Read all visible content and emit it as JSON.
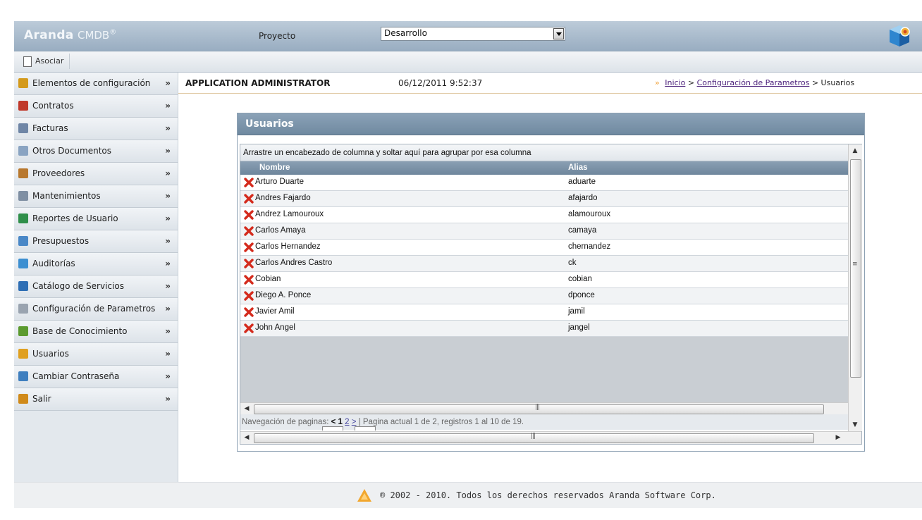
{
  "header": {
    "logo_main": "Aranda",
    "logo_sub": "CMDB",
    "logo_mark": "®",
    "project_label": "Proyecto",
    "project_value": "Desarrollo"
  },
  "toolbar": {
    "asociar_label": "Asociar"
  },
  "sidebar": {
    "items": [
      {
        "label": "Elementos de configuración",
        "icon": "config-elements-icon",
        "color": "#d49a1c"
      },
      {
        "label": "Contratos",
        "icon": "contract-pen-icon",
        "color": "#c0392b"
      },
      {
        "label": "Facturas",
        "icon": "invoice-icon",
        "color": "#6f86a6"
      },
      {
        "label": "Otros Documentos",
        "icon": "documents-icon",
        "color": "#8aa4c2"
      },
      {
        "label": "Proveedores",
        "icon": "supplier-icon",
        "color": "#b8782e"
      },
      {
        "label": "Mantenimientos",
        "icon": "maintenance-icon",
        "color": "#7f8fa3"
      },
      {
        "label": "Reportes de Usuario",
        "icon": "user-report-icon",
        "color": "#2f8f4a"
      },
      {
        "label": "Presupuestos",
        "icon": "calculator-icon",
        "color": "#4a88c7"
      },
      {
        "label": "Auditorías",
        "icon": "audit-icon",
        "color": "#3c8fd1"
      },
      {
        "label": "Catálogo de Servicios",
        "icon": "service-catalog-icon",
        "color": "#2f6fb5"
      },
      {
        "label": "Configuración de Parametros",
        "icon": "gear-icon",
        "color": "#9aa4b0"
      },
      {
        "label": "Base de Conocimiento",
        "icon": "knowledge-books-icon",
        "color": "#5b9a2f"
      },
      {
        "label": "Usuarios",
        "icon": "users-icon",
        "color": "#e0a020"
      },
      {
        "label": "Cambiar Contraseña",
        "icon": "change-password-icon",
        "color": "#3f7fbf"
      },
      {
        "label": "Salir",
        "icon": "exit-icon",
        "color": "#d08a1a"
      }
    ],
    "chevron": "»"
  },
  "info": {
    "user": "APPLICATION ADMINISTRATOR",
    "datetime": "06/12/2011 9:52:37",
    "breadcrumb": {
      "arrow": "»",
      "home": "Inicio",
      "sep1": ">",
      "config": "Configuración de Parametros",
      "sep2": ">",
      "current": "Usuarios"
    }
  },
  "panel": {
    "title": "Usuarios",
    "group_hint": "Arrastre un encabezado de columna y soltar aquí para agrupar por esa columna",
    "columns": {
      "nombre": "Nombre",
      "alias": "Alias"
    },
    "rows": [
      {
        "nombre": "Arturo Duarte",
        "alias": "aduarte"
      },
      {
        "nombre": "Andres Fajardo",
        "alias": "afajardo"
      },
      {
        "nombre": "Andrez Lamouroux",
        "alias": "alamouroux"
      },
      {
        "nombre": "Carlos Amaya",
        "alias": "camaya"
      },
      {
        "nombre": "Carlos Hernandez",
        "alias": "chernandez"
      },
      {
        "nombre": "Carlos Andres Castro",
        "alias": "ck"
      },
      {
        "nombre": "Cobian",
        "alias": "cobian"
      },
      {
        "nombre": "Diego A. Ponce",
        "alias": "dponce"
      },
      {
        "nombre": "Javier Amil",
        "alias": "jamil"
      },
      {
        "nombre": "John Angel",
        "alias": "jangel"
      }
    ],
    "pager": {
      "prefix": "Navegación de paginas:",
      "prev": "<",
      "page1": "1",
      "page2": "2",
      "next": ">",
      "sep": "|",
      "status": "Pagina actual 1 de 2, registros 1 al 10 de 19."
    }
  },
  "footer": {
    "text": "® 2002 - 2010. Todos los derechos reservados Aranda Software Corp."
  }
}
